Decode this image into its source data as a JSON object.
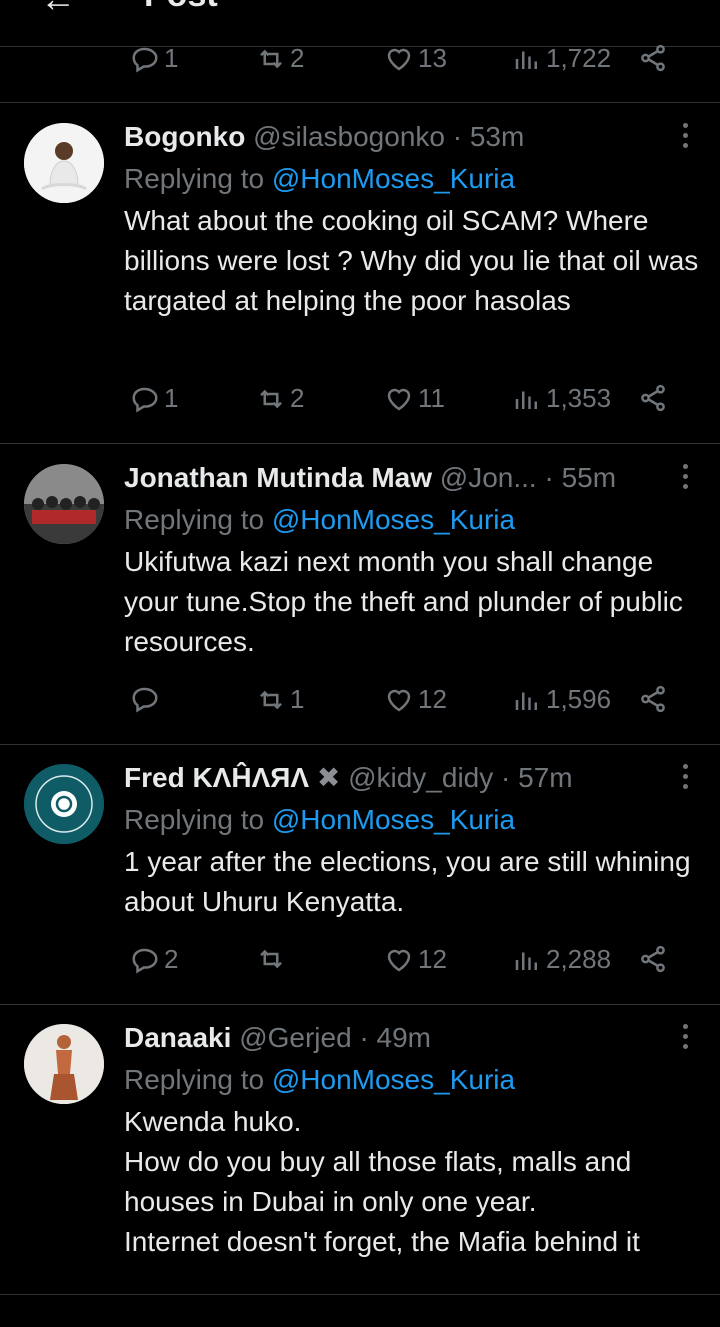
{
  "header": {
    "back_glyph": "←",
    "title": "Post"
  },
  "top_actions": {
    "replies": "1",
    "reposts": "2",
    "likes": "13",
    "views": "1,722"
  },
  "tweets": [
    {
      "name": "Bogonko",
      "handle": "@silasbogonko",
      "time": "· 53m",
      "replying_label": "Replying to",
      "replying_to": "@HonMoses_Kuria",
      "text": "What about the cooking oil SCAM? Where billions were lost ? Why did you lie that oil was targated at helping the poor hasolas",
      "replies": "1",
      "reposts": "2",
      "likes": "11",
      "views": "1,353"
    },
    {
      "name": "Jonathan Mutinda Maw",
      "handle": "@Jon...",
      "time": "· 55m",
      "replying_label": "Replying to",
      "replying_to": "@HonMoses_Kuria",
      "text": "Ukifutwa kazi next month you shall change your tune.Stop the theft and plunder of public resources.",
      "replies": "",
      "reposts": "1",
      "likes": "12",
      "views": "1,596"
    },
    {
      "name": "Fred KΛĤΛЯΛ",
      "handle": "@kidy_didy",
      "time": "· 57m",
      "replying_label": "Replying to",
      "replying_to": "@HonMoses_Kuria",
      "text": "1 year after the elections, you are still whining about Uhuru Kenyatta.",
      "replies": "2",
      "reposts": "",
      "likes": "12",
      "views": "2,288"
    },
    {
      "name": "Danaaki",
      "handle": "@Gerjed",
      "time": "· 49m",
      "replying_label": "Replying to",
      "replying_to": "@HonMoses_Kuria",
      "text": "Kwenda huko.\nHow do you buy all those flats, malls and houses in Dubai in only one year.\nInternet doesn't forget, the Mafia behind it",
      "replies": "",
      "reposts": "",
      "likes": "",
      "views": ""
    }
  ],
  "colors": {
    "background": "#000000",
    "text": "#e7e9ea",
    "muted": "#71767b",
    "link": "#1d9bf0",
    "divider": "#2f3336"
  }
}
